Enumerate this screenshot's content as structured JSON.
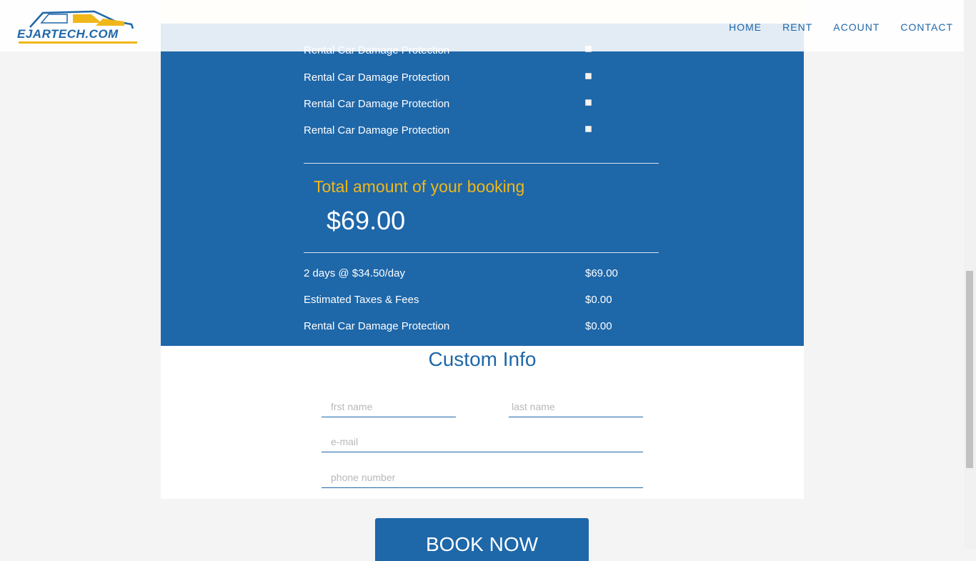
{
  "header": {
    "logo_text": "EJARTECH.COM",
    "nav": [
      "HOME",
      "RENT",
      "ACOUNT",
      "CONTACT"
    ]
  },
  "protections": {
    "items": [
      "Rental Car Damage Protection",
      "Rental Car Damage Protection",
      "Rental Car Damage Protection",
      "Rental Car Damage Protection"
    ]
  },
  "total": {
    "title": "Total amount of your booking",
    "amount": "$69.00"
  },
  "breakdown": [
    {
      "label": "2 days @ $34.50/day",
      "value": "$69.00"
    },
    {
      "label": "Estimated Taxes & Fees",
      "value": "$0.00"
    },
    {
      "label": "Rental Car Damage Protection",
      "value": "$0.00"
    }
  ],
  "custom_info": {
    "title": "Custom Info",
    "first_name_placeholder": "frst name",
    "last_name_placeholder": "last name",
    "email_placeholder": "e-mail",
    "phone_placeholder": "phone number"
  },
  "book_button": "BOOK NOW",
  "colors": {
    "brand_blue": "#1e67a9",
    "accent_yellow": "#f0b719",
    "cream": "#f8f0dc"
  }
}
